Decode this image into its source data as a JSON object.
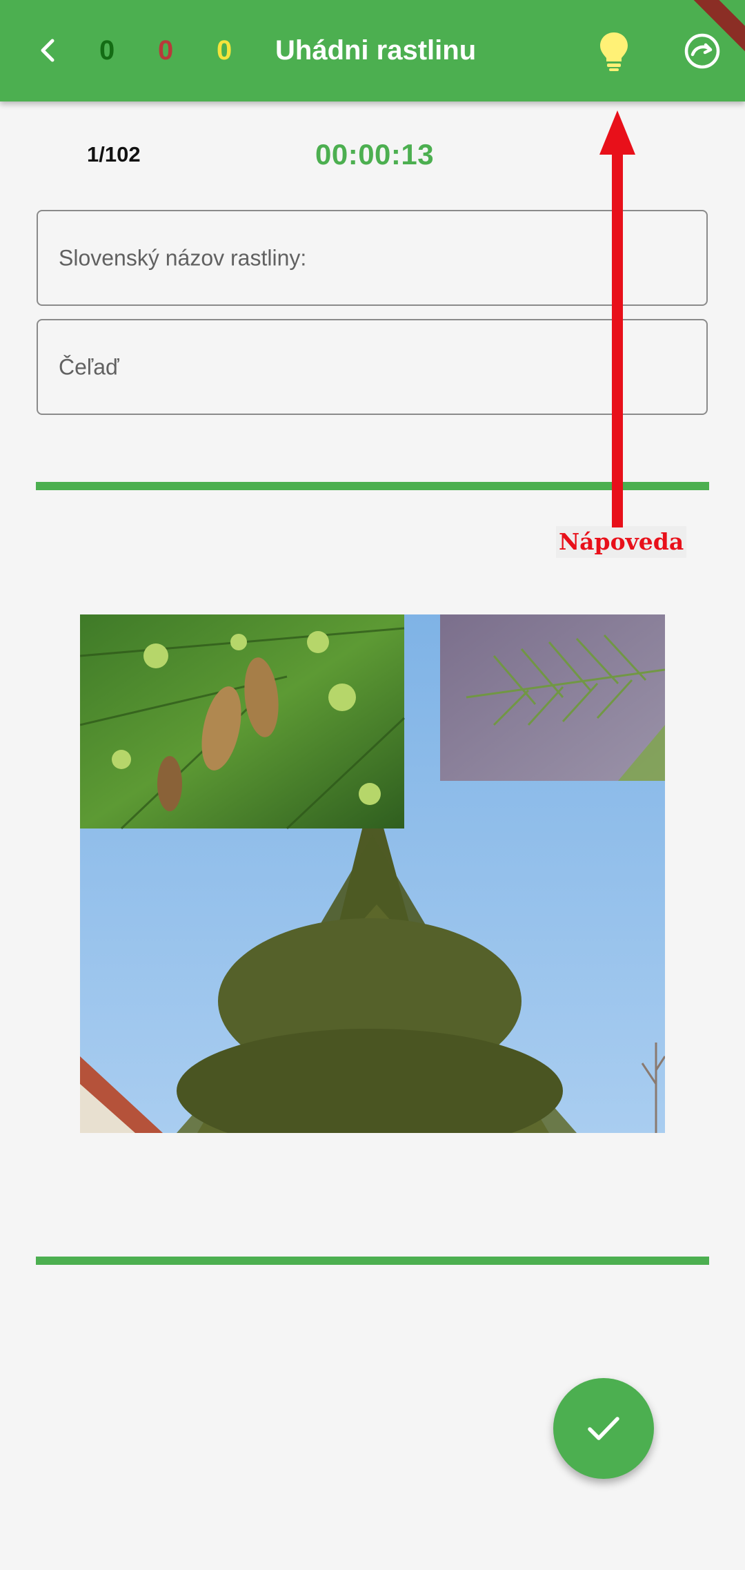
{
  "appbar": {
    "title": "Uhádni rastlinu",
    "score_correct": "0",
    "score_wrong": "0",
    "score_hint": "0",
    "color_background": "#4caf50",
    "color_correct": "#146c14",
    "color_wrong": "#b83a3a",
    "color_hint": "#f5e43c",
    "back_icon": "chevron-left-icon",
    "hint_icon": "lightbulb-icon",
    "next_icon": "circle-arrow-icon"
  },
  "quiz": {
    "counter": "1/102",
    "timer": "00:00:13"
  },
  "form": {
    "name_placeholder": "Slovenský názov rastliny:",
    "family_placeholder": "Čeľaď"
  },
  "annotation": {
    "label": "Nápoveda",
    "color": "#e8101a"
  },
  "fab": {
    "icon": "check-icon"
  }
}
